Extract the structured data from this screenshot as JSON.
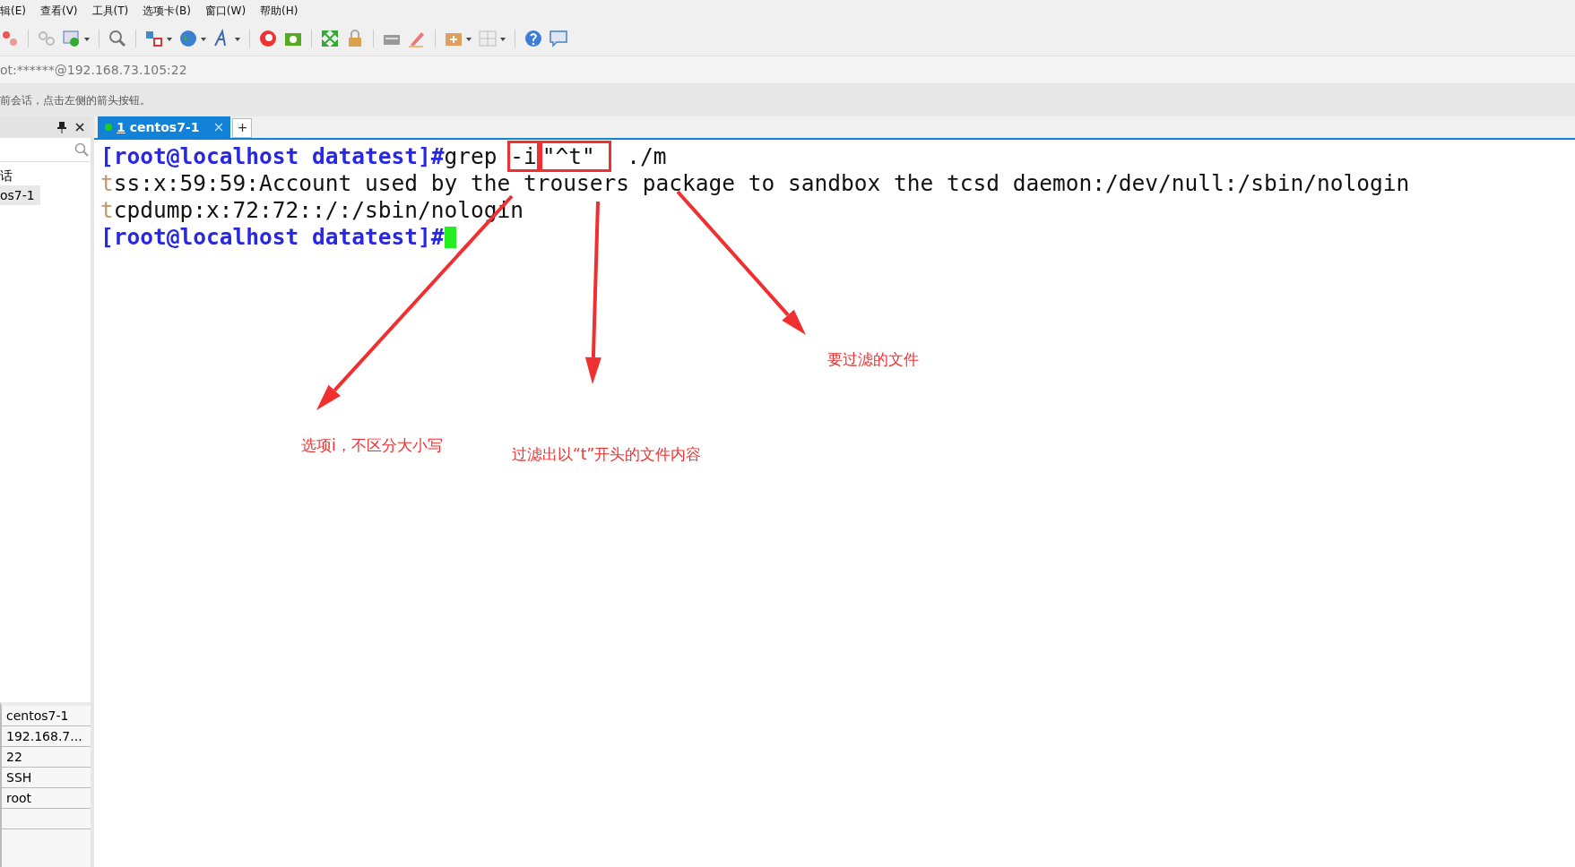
{
  "menu_bar": {
    "items": [
      "辑(E)",
      "查看(V)",
      "工具(T)",
      "选项卡(B)",
      "窗口(W)",
      "帮助(H)"
    ]
  },
  "address_bar": {
    "value": "ot:******@192.168.73.105:22"
  },
  "info_bar": {
    "text": "前会话，点击左侧的箭头按钮。"
  },
  "session_panel": {
    "tree_items": [
      {
        "label": "话",
        "selected": false
      },
      {
        "label": "os7-1",
        "selected": true
      }
    ],
    "properties": [
      "centos7-1",
      "192.168.7...",
      "22",
      "SSH",
      "root"
    ]
  },
  "tabs": [
    {
      "number": "1",
      "label": "centos7-1",
      "selected": true,
      "connected": true
    }
  ],
  "new_tab_button": "+",
  "terminal": {
    "lines": [
      [
        {
          "kind": "prompt",
          "text": "[root@localhost datatest]#"
        },
        {
          "kind": "plain",
          "text": "grep "
        },
        {
          "kind": "boxed",
          "text": "-i"
        },
        {
          "kind": "boxed",
          "text": "\"^t\" "
        },
        {
          "kind": "plain",
          "text": " ./m"
        }
      ],
      [
        {
          "kind": "match",
          "text": "t"
        },
        {
          "kind": "plain",
          "text": "ss:x:59:59:Account used by the trousers package to sandbox the tcsd daemon:/dev/null:/sbin/nologin"
        }
      ],
      [
        {
          "kind": "match",
          "text": "t"
        },
        {
          "kind": "plain",
          "text": "cpdump:x:72:72::/:/sbin/nologin"
        }
      ],
      [
        {
          "kind": "prompt",
          "text": "[root@localhost datatest]#"
        },
        {
          "kind": "cursor"
        }
      ]
    ],
    "annotations": [
      {
        "text": "选项i，不区分大小写"
      },
      {
        "text": "过滤出以“t”开头的文件内容"
      },
      {
        "text": "要过滤的文件"
      }
    ]
  }
}
